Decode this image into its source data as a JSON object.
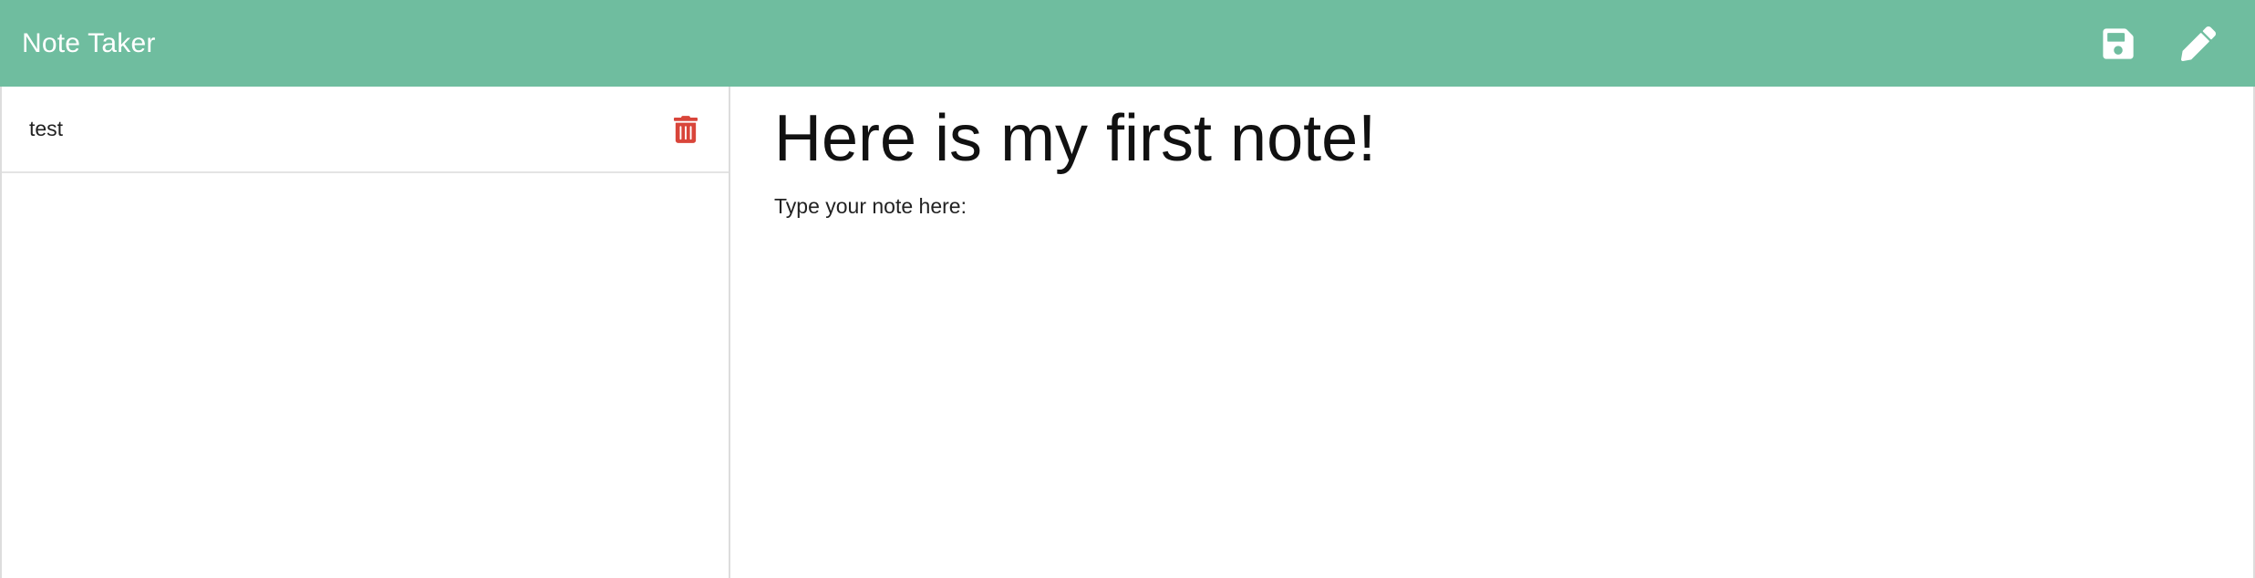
{
  "colors": {
    "navbar_bg": "#6fbd9f",
    "nav_icon": "#ffffff",
    "delete_icon": "#d9453a"
  },
  "header": {
    "brand": "Note Taker",
    "save_icon": "floppy-disk-icon",
    "new_note_icon": "pencil-icon"
  },
  "sidebar": {
    "notes": [
      {
        "title": "test",
        "action_icon": "trash-icon"
      }
    ]
  },
  "editor": {
    "title": "Here is my first note!",
    "body": "Type your note here:"
  }
}
